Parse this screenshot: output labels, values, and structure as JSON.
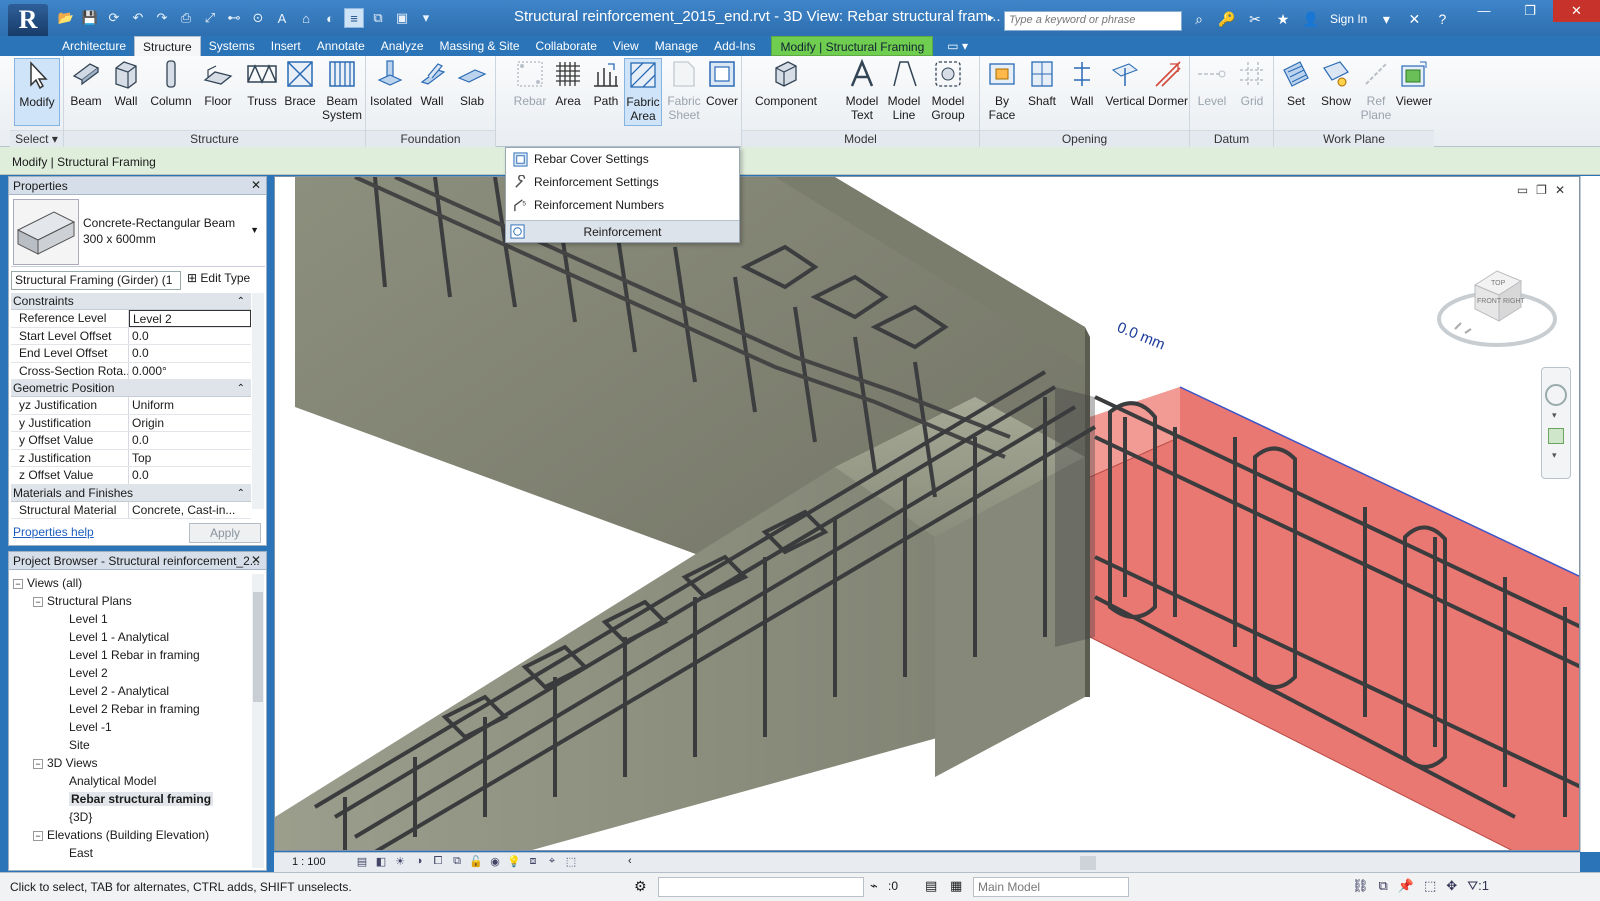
{
  "title": {
    "file_text": "Structural reinforcement_2015_end.rvt - 3D View: Rebar structural fram...",
    "more": "▸",
    "search_placeholder": "Type a keyword or phrase",
    "sign_in": "Sign In"
  },
  "tabs": [
    "Architecture",
    "Structure",
    "Systems",
    "Insert",
    "Annotate",
    "Analyze",
    "Massing & Site",
    "Collaborate",
    "View",
    "Manage",
    "Add-Ins"
  ],
  "context_tab": "Modify | Structural Framing",
  "active_tab": "Structure",
  "ribbon": {
    "select": {
      "button": "Modify",
      "title": "Select"
    },
    "structure": {
      "title": "Structure",
      "buttons": [
        "Beam",
        "Wall",
        "Column",
        "Floor",
        "Truss",
        "Brace",
        "Beam System"
      ]
    },
    "foundation": {
      "title": "Foundation",
      "buttons": [
        "Isolated",
        "Wall",
        "Slab"
      ]
    },
    "reinforcement": {
      "buttons": [
        "Rebar",
        "Area",
        "Path",
        "Fabric Area",
        "Fabric Sheet",
        "Cover"
      ]
    },
    "model": {
      "title": "Model",
      "buttons": [
        "Component",
        "Model Text",
        "Model Line",
        "Model Group"
      ]
    },
    "opening": {
      "title": "Opening",
      "buttons": [
        "By Face",
        "Shaft",
        "Wall",
        "Vertical",
        "Dormer"
      ]
    },
    "datum": {
      "title": "Datum",
      "buttons": [
        "Level",
        "Grid"
      ]
    },
    "workplane": {
      "title": "Work Plane",
      "buttons": [
        "Set",
        "Show",
        "Ref Plane",
        "Viewer"
      ]
    }
  },
  "option_bar": "Modify | Structural Framing",
  "dropdown": {
    "items": [
      "Rebar Cover Settings",
      "Reinforcement Settings",
      "Reinforcement Numbers"
    ],
    "footer": "Reinforcement"
  },
  "properties": {
    "header": "Properties",
    "type_name_1": "Concrete-Rectangular Beam",
    "type_name_2": "300 x 600mm",
    "instance": "Structural Framing (Girder) (1",
    "edit_type": "Edit Type",
    "groups": [
      {
        "name": "Constraints",
        "rows": [
          {
            "k": "Reference Level",
            "v": "Level 2"
          },
          {
            "k": "Start Level Offset",
            "v": "0.0"
          },
          {
            "k": "End Level Offset",
            "v": "0.0"
          },
          {
            "k": "Cross-Section Rota...",
            "v": "0.000°"
          }
        ]
      },
      {
        "name": "Geometric Position",
        "rows": [
          {
            "k": "yz Justification",
            "v": "Uniform"
          },
          {
            "k": "y Justification",
            "v": "Origin"
          },
          {
            "k": "y Offset Value",
            "v": "0.0"
          },
          {
            "k": "z Justification",
            "v": "Top"
          },
          {
            "k": "z Offset Value",
            "v": "0.0"
          }
        ]
      },
      {
        "name": "Materials and Finishes",
        "rows": [
          {
            "k": "Structural Material",
            "v": "Concrete, Cast-in..."
          }
        ]
      }
    ],
    "help": "Properties help",
    "apply": "Apply"
  },
  "browser": {
    "header": "Project Browser - Structural reinforcement_2...",
    "nodes": [
      {
        "label": "Views (all)",
        "level": 0,
        "exp": "−"
      },
      {
        "label": "Structural Plans",
        "level": 1,
        "exp": "−"
      },
      {
        "label": "Level 1",
        "level": 2
      },
      {
        "label": "Level 1 - Analytical",
        "level": 2
      },
      {
        "label": "Level 1 Rebar in framing",
        "level": 2
      },
      {
        "label": "Level 2",
        "level": 2
      },
      {
        "label": "Level 2 - Analytical",
        "level": 2
      },
      {
        "label": "Level 2 Rebar in framing",
        "level": 2
      },
      {
        "label": "Level -1",
        "level": 2
      },
      {
        "label": "Site",
        "level": 2
      },
      {
        "label": "3D Views",
        "level": 1,
        "exp": "−"
      },
      {
        "label": "Analytical Model",
        "level": 2
      },
      {
        "label": "Rebar structural framing",
        "level": 2,
        "selected": true
      },
      {
        "label": "{3D}",
        "level": 2
      },
      {
        "label": "Elevations (Building Elevation)",
        "level": 1,
        "exp": "−"
      },
      {
        "label": "East",
        "level": 2
      }
    ]
  },
  "viewport": {
    "dimension": "0.0 mm",
    "viewcube_top": "TOP",
    "viewcube_front": "FRONT",
    "viewcube_right": "RIGHT",
    "scale": "1 : 100"
  },
  "status": {
    "text": "Click to select, TAB for alternates, CTRL adds, SHIFT unselects.",
    "num": ":0",
    "model": "Main Model",
    "filter": ":1"
  },
  "colors": {
    "title_bar": "#2b74b8",
    "context_tab": "#6fcd4f",
    "selected_element": "#e8706a",
    "concrete": "#8f917f"
  }
}
